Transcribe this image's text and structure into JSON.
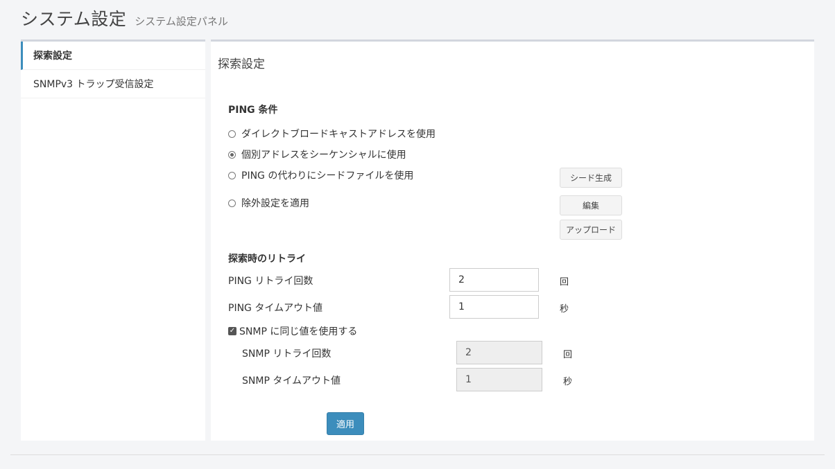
{
  "header": {
    "title": "システム設定",
    "subtitle": "システム設定パネル"
  },
  "sidebar": {
    "items": [
      {
        "label": "探索設定",
        "active": true
      },
      {
        "label": "SNMPv3 トラップ受信設定",
        "active": false
      }
    ]
  },
  "main": {
    "title": "探索設定",
    "ping": {
      "section_label": "PING 条件",
      "options": [
        {
          "label": "ダイレクトブロードキャストアドレスを使用",
          "checked": false
        },
        {
          "label": "個別アドレスをシーケンシャルに使用",
          "checked": true
        },
        {
          "label": "PING の代わりにシードファイルを使用",
          "checked": false
        },
        {
          "label": "除外設定を適用",
          "checked": false
        }
      ],
      "seed_button": "シード生成",
      "edit_button": "編集",
      "upload_button": "アップロード"
    },
    "retry": {
      "section_label": "探索時のリトライ",
      "ping_retry_label": "PING リトライ回数",
      "ping_retry_value": "2",
      "ping_retry_unit": "回",
      "ping_timeout_label": "PING タイムアウト値",
      "ping_timeout_value": "1",
      "ping_timeout_unit": "秒",
      "snmp_same_label": "SNMP に同じ値を使用する",
      "snmp_same_checked": true,
      "snmp_retry_label": "SNMP リトライ回数",
      "snmp_retry_value": "2",
      "snmp_retry_unit": "回",
      "snmp_timeout_label": "SNMP タイムアウト値",
      "snmp_timeout_value": "1",
      "snmp_timeout_unit": "秒"
    },
    "apply_button": "適用"
  },
  "colors": {
    "primary": "#3c8dbc",
    "background": "#f4f5f7"
  }
}
